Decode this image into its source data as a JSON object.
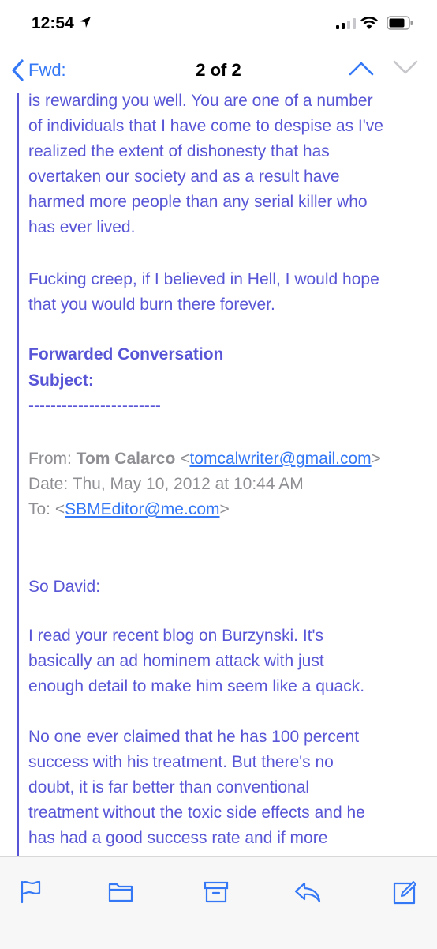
{
  "status_bar": {
    "time": "12:54",
    "icons": [
      "location-arrow-icon",
      "signal-icon",
      "wifi-icon",
      "battery-icon"
    ]
  },
  "nav": {
    "back_label": "Fwd:",
    "title": "2 of 2",
    "icons": [
      "chevron-left-icon",
      "chevron-up-icon",
      "chevron-down-icon"
    ]
  },
  "email": {
    "para1": [
      "is rewarding you well.  You are one of a number",
      "of individuals that I have come to despise as I've",
      "realized the extent of dishonesty that has",
      "overtaken our society and as a result have",
      "harmed more people than any serial killer who",
      "has ever lived."
    ],
    "para2": [
      "Fucking creep, if I believed in Hell, I would hope",
      "that you would burn there forever."
    ],
    "forwarded_heading": "Forwarded Conversation",
    "subject_label": "Subject:",
    "separator": "------------------------",
    "from_label": "From:",
    "from_name": "Tom Calarco",
    "from_email": "tomcalwriter@gmail.com",
    "date_label": "Date:",
    "date_value": "Thu, May 10, 2012 at 10:44 AM",
    "to_label": "To:",
    "to_email": "SBMEditor@me.com",
    "greeting": "So David:",
    "para3": [
      "I read your recent blog on Burzynski.  It's",
      "basically an ad hominem attack with just",
      "enough detail to make him seem like a quack."
    ],
    "para4": [
      "No one ever claimed that he has 100 percent",
      "success with his treatment.  But there's no",
      "doubt, it is far better than conventional",
      "treatment without the toxic side effects and he",
      "has had a good success rate and if more"
    ]
  },
  "toolbar": {
    "icons": [
      "flag-icon",
      "folder-icon",
      "archive-icon",
      "reply-icon",
      "compose-icon"
    ]
  },
  "colors": {
    "accent": "#3478f6",
    "quote_text": "#5856d6",
    "gray_text": "#8e8e93"
  }
}
